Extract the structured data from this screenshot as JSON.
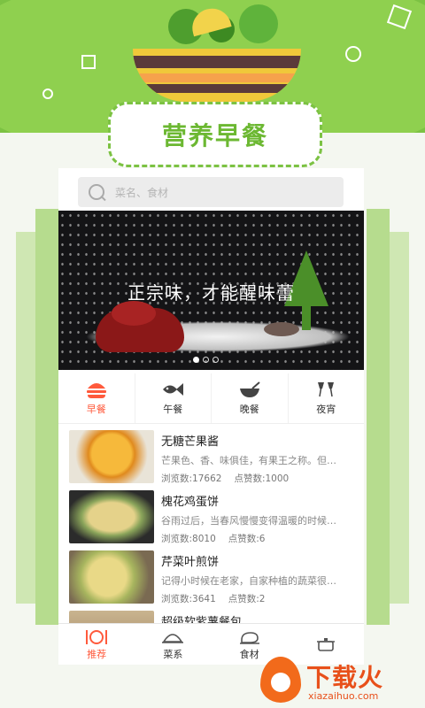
{
  "app": {
    "hero_title": "营养早餐"
  },
  "search": {
    "placeholder": "菜名、食材"
  },
  "banner": {
    "caption": "正宗味，才能醒味蕾",
    "page_count": 3,
    "active_page": 1
  },
  "categories": [
    {
      "label": "早餐",
      "icon": "burger-icon",
      "active": true
    },
    {
      "label": "午餐",
      "icon": "fish-icon",
      "active": false
    },
    {
      "label": "晚餐",
      "icon": "bowl-icon",
      "active": false
    },
    {
      "label": "夜宵",
      "icon": "wine-glasses-icon",
      "active": false
    }
  ],
  "recipes": [
    {
      "title": "无糖芒果酱",
      "desc": "芒果色、香、味俱佳，有果王之称。但…",
      "views_label": "浏览数:17662",
      "likes_label": "点赞数:1000"
    },
    {
      "title": "槐花鸡蛋饼",
      "desc": "谷雨过后，当春风慢慢变得温暖的时候…",
      "views_label": "浏览数:8010",
      "likes_label": "点赞数:6"
    },
    {
      "title": "芹菜叶煎饼",
      "desc": "记得小时候在老家，自家种植的蔬菜很…",
      "views_label": "浏览数:3641",
      "likes_label": "点赞数:2"
    },
    {
      "title": "超级软紫薯餐包",
      "desc": "",
      "views_label": "",
      "likes_label": ""
    }
  ],
  "tabbar": [
    {
      "label": "推荐",
      "icon": "plate-cutlery-icon",
      "active": true
    },
    {
      "label": "菜系",
      "icon": "cloche-icon",
      "active": false
    },
    {
      "label": "食材",
      "icon": "chicken-icon",
      "active": false
    },
    {
      "label": "",
      "icon": "pot-icon",
      "active": false
    }
  ],
  "watermark": {
    "text": "下载火",
    "url": "xiazaihuo.com"
  },
  "colors": {
    "brand_green": "#7cc243",
    "accent_red": "#ff5a3c"
  }
}
